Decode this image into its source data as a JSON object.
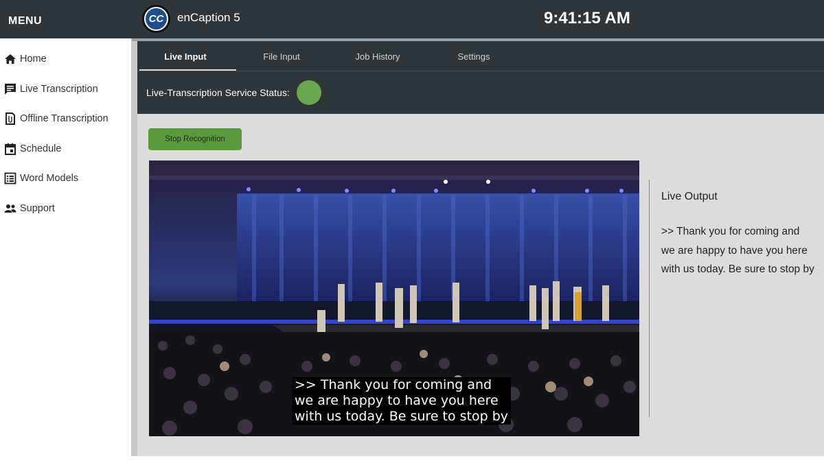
{
  "menu": {
    "title": "MENU"
  },
  "sidebar": {
    "items": [
      {
        "label": "Home",
        "icon": "home-icon"
      },
      {
        "label": "Live Transcription",
        "icon": "transcript-icon"
      },
      {
        "label": "Offline Transcription",
        "icon": "file-icon"
      },
      {
        "label": "Schedule",
        "icon": "calendar-icon"
      },
      {
        "label": "Word Models",
        "icon": "list-icon"
      },
      {
        "label": "Support",
        "icon": "people-icon"
      }
    ]
  },
  "header": {
    "logo_text": "CC",
    "app_title": "enCaption 5",
    "clock": "9:41:15 AM"
  },
  "tabs": [
    {
      "label": "Live Input",
      "active": true
    },
    {
      "label": "File Input",
      "active": false
    },
    {
      "label": "Job History",
      "active": false
    },
    {
      "label": "Settings",
      "active": false
    }
  ],
  "status": {
    "label": "Live-Transcription Service Status:",
    "color": "#6aa84f"
  },
  "actions": {
    "stop_label": "Stop Recognition"
  },
  "video": {
    "caption_lines": [
      ">> Thank you for coming and",
      "we are happy to have you here",
      "with us today. Be sure to stop by"
    ]
  },
  "live_output": {
    "title": "Live Output",
    "lines": [
      ">> Thank you for coming and",
      "we are happy to have you here",
      "with us today. Be sure to stop by"
    ]
  },
  "colors": {
    "topbar": "#2f3539",
    "accent_green": "#5a9a3c",
    "content_bg": "#dcdcdc"
  }
}
